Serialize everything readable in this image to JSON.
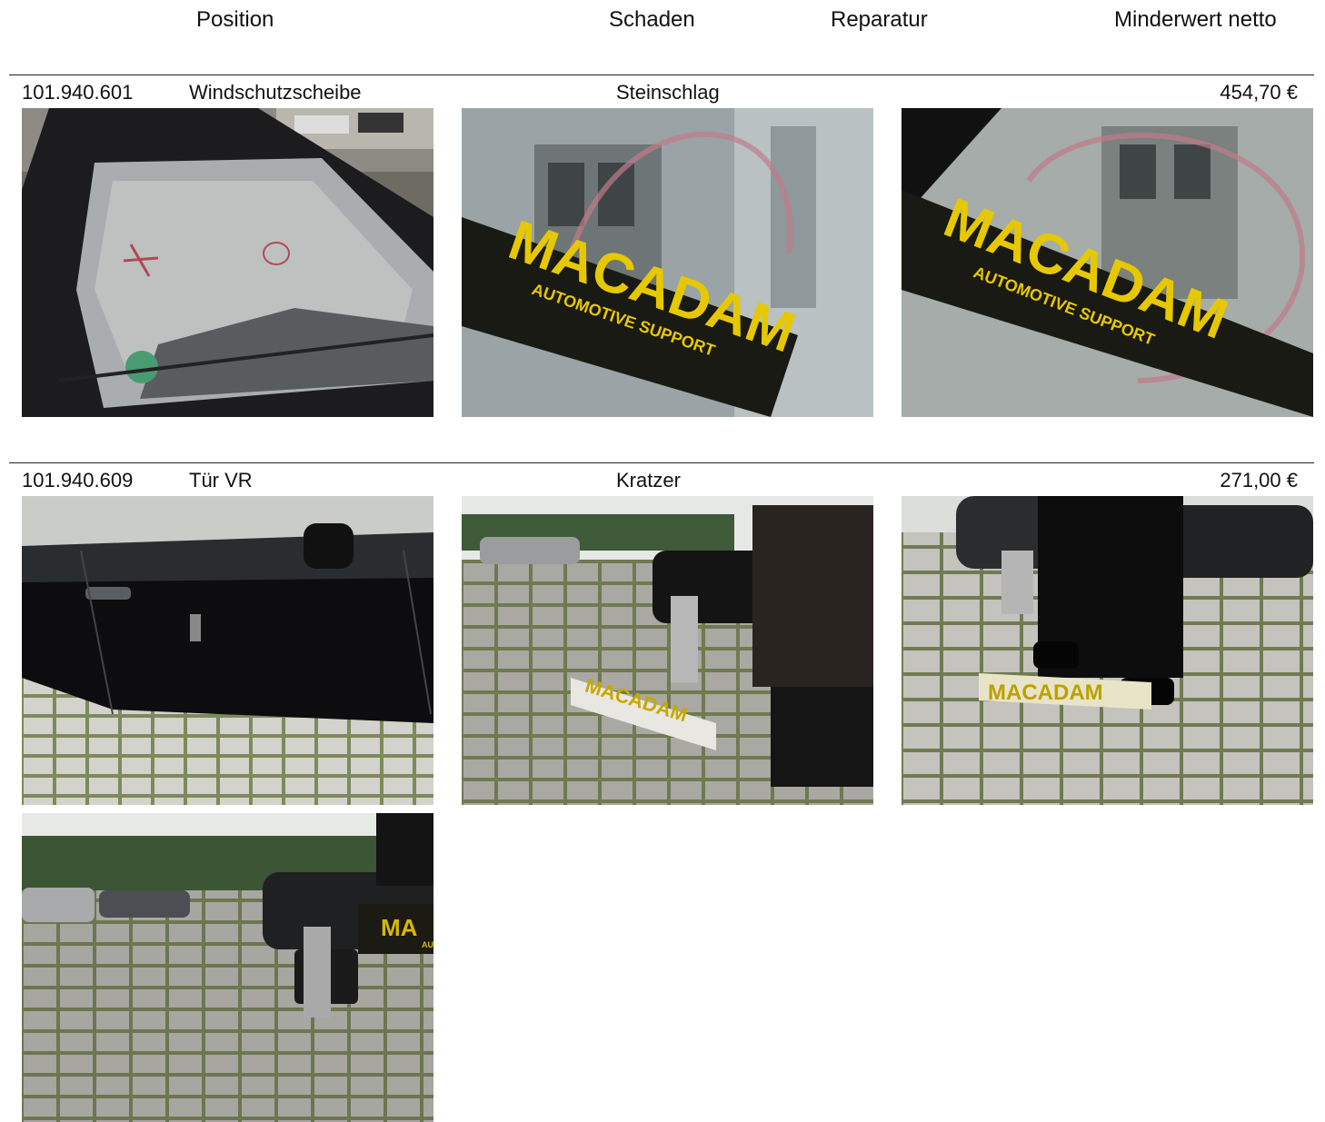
{
  "header": {
    "position": "Position",
    "schaden": "Schaden",
    "reparatur": "Reparatur",
    "minderwert": "Minderwert netto"
  },
  "items": [
    {
      "code": "101.940.601",
      "part": "Windschutzscheibe",
      "damage": "Steinschlag",
      "value": "454,70 €",
      "photos": [
        {
          "label": "photo-windshield-overview",
          "ruler_text": "",
          "ruler_sub": "",
          "rt0": ""
        },
        {
          "label": "photo-windshield-ruler-1",
          "ruler_text": "MACADAM",
          "ruler_sub": "AUTOMOTIVE SUPPORT"
        },
        {
          "label": "photo-windshield-ruler-2",
          "ruler_text": "MACADAM",
          "ruler_sub": "AUTOMOTIVE SUPPORT"
        }
      ]
    },
    {
      "code": "101.940.609",
      "part": "Tür VR",
      "damage": "Kratzer",
      "value": "271,00 €",
      "photos": [
        {
          "label": "photo-door-overview"
        },
        {
          "label": "photo-door-ruler-1",
          "ruler_text": "MACADAM"
        },
        {
          "label": "photo-door-ruler-2",
          "ruler_text": "MACADAM"
        },
        {
          "label": "photo-door-ruler-3",
          "ruler_text": "MA",
          "ruler_sub": "AUTO"
        }
      ]
    }
  ]
}
